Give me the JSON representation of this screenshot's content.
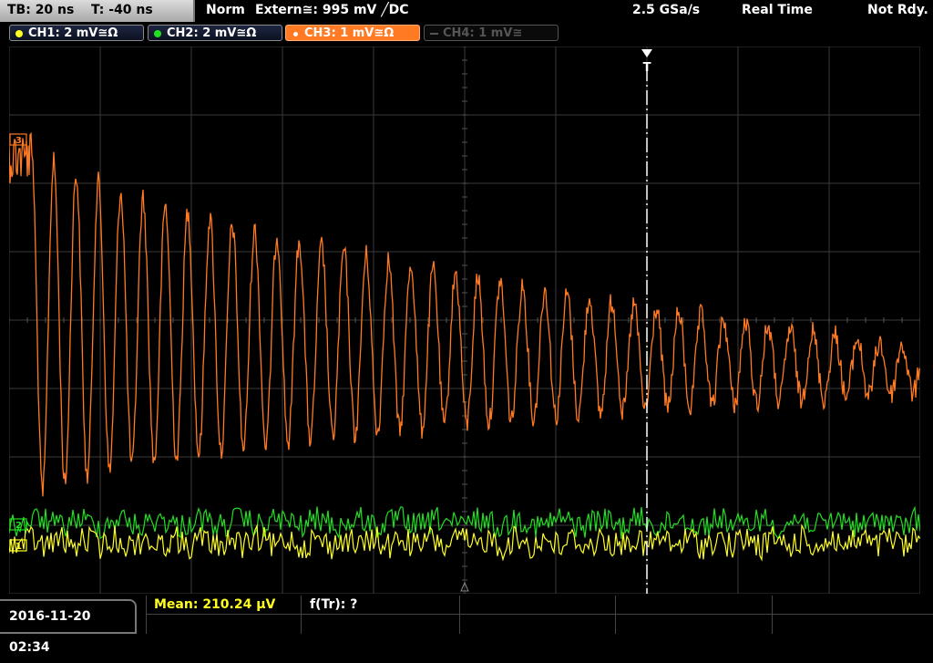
{
  "timebase": {
    "tb": "TB: 20 ns",
    "t": "T: -40 ns"
  },
  "status": {
    "mode": "Norm",
    "trigger": "Extern≅: 995 mV ╱DC",
    "sample_rate": "2.5 GSa/s",
    "acquisition": "Real Time",
    "state": "Not Rdy."
  },
  "channels": [
    {
      "label": "CH1: 2 mV≅Ω",
      "color": "#ffff20",
      "active": false
    },
    {
      "label": "CH2: 2 mV≅Ω",
      "color": "#20e020",
      "active": false
    },
    {
      "label": "CH3: 1 mV≅Ω",
      "color": "#ff7a22",
      "active": true
    },
    {
      "label": "CH4: 1 mV≅",
      "color": "#555555",
      "active": false,
      "off": true
    }
  ],
  "markers": {
    "ch3": "3",
    "ch2": "2",
    "ch1": "1",
    "trigger": "T"
  },
  "footer": {
    "datetime": "2016-11-20 02:34",
    "measure1": "Mean: 210.24 µV",
    "measure2": "f(Tr): ?"
  },
  "colors": {
    "ch1": "#ffff20",
    "ch2": "#20e020",
    "ch3": "#ff7a22",
    "grid": "#3a3a3a",
    "trigger_line": "#ffffff"
  }
}
